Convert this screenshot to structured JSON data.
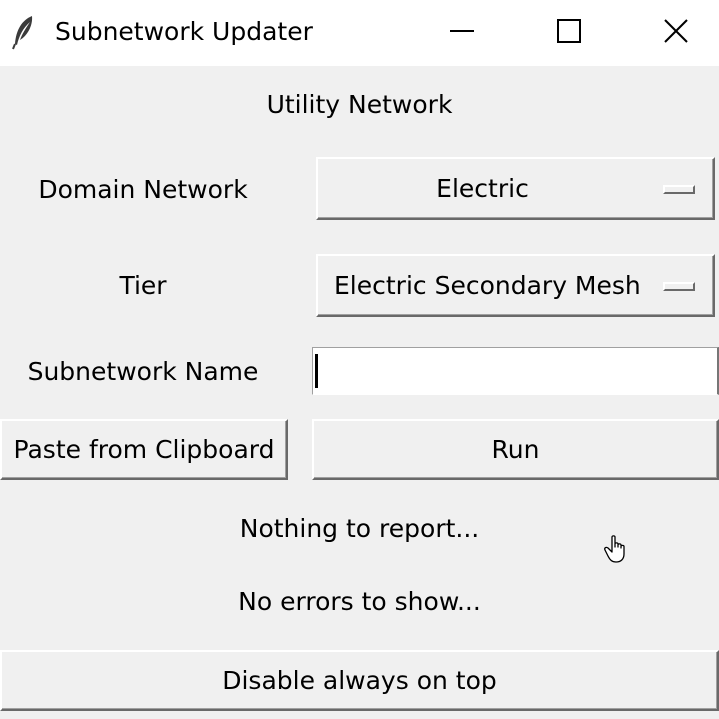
{
  "window": {
    "title": "Subnetwork Updater",
    "icon": "feather-icon"
  },
  "header": {
    "title": "Utility Network"
  },
  "form": {
    "domain_network": {
      "label": "Domain Network",
      "selected": "Electric"
    },
    "tier": {
      "label": "Tier",
      "selected": "Electric Secondary Mesh"
    },
    "subnetwork_name": {
      "label": "Subnetwork Name",
      "value": ""
    }
  },
  "buttons": {
    "paste": "Paste from Clipboard",
    "run": "Run",
    "always_on_top": "Disable always on top"
  },
  "status": {
    "report": "Nothing to report...",
    "errors": "No errors to show..."
  },
  "colors": {
    "background": "#f0f0f0",
    "titlebar": "#ffffff",
    "text": "#000000"
  }
}
